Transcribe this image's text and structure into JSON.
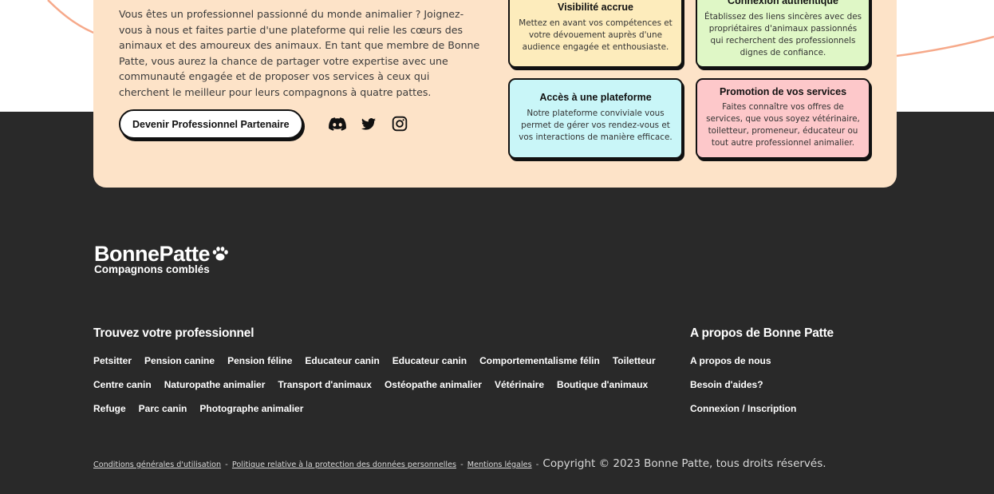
{
  "brand": {
    "name": "BonnePatte",
    "tagline": "Compagnons comblés",
    "accent_color": "#fde3c8",
    "dark_color": "#292929",
    "deco_color": "#f6a98a"
  },
  "partner_section": {
    "intro": "Vous êtes un professionnel passionné du monde animalier ? Joignez-vous à nous et faites partie d'une plateforme qui relie les cœurs des animaux et des amoureux des animaux. En tant que membre de Bonne Patte, vous aurez la chance de partager votre expertise avec une communauté engagée et de proposer vos services à ceux qui cherchent le meilleur pour leurs compagnons à quatre pattes.",
    "cta_label": "Devenir Professionnel Partenaire",
    "socials": [
      "discord-icon",
      "twitter-icon",
      "instagram-icon"
    ],
    "features": [
      {
        "title": "Visibilité accrue",
        "desc": "Mettez en avant vos compétences et votre dévouement auprès d'une audience engagée et enthousiaste.",
        "color": "#fdecbc"
      },
      {
        "title": "Connexion authentique",
        "desc": "Établissez des liens sincères avec des propriétaires d'animaux passionnés qui recherchent des professionnels dignes de confiance.",
        "color": "#dff7c6"
      },
      {
        "title": "Accès à une plateforme",
        "desc": "Notre plateforme conviviale vous permet de gérer vos rendez-vous et vos interactions de manière efficace.",
        "color": "#c9f6f8"
      },
      {
        "title": "Promotion de vos services",
        "desc": "Faites connaître vos offres de services, que vous soyez vétérinaire, toiletteur, promeneur, éducateur ou tout autre professionnel animalier.",
        "color": "#fdc8ca"
      }
    ]
  },
  "footer": {
    "find_title": "Trouvez votre professionnel",
    "find_rows": [
      [
        "Petsitter",
        "Pension canine",
        "Pension féline",
        "Educateur canin",
        "Educateur canin",
        "Comportementalisme félin",
        "Toiletteur"
      ],
      [
        "Centre canin",
        "Naturopathe animalier",
        "Transport d'animaux",
        "Ostéopathe animalier",
        "Vétérinaire",
        "Boutique d'animaux"
      ],
      [
        "Refuge",
        "Parc canin",
        "Photographe animalier"
      ]
    ],
    "about_title": "A propos de Bonne Patte",
    "about_links": [
      "A propos de nous",
      "Besoin d'aides?",
      "Connexion / Inscription"
    ],
    "legal_links": [
      "Conditions générales d'utilisation",
      "Politique relative à la protection des données personnelles",
      "Mentions légales"
    ],
    "separator": "-",
    "copyright": "Copyright © 2023 Bonne Patte, tous droits réservés."
  }
}
